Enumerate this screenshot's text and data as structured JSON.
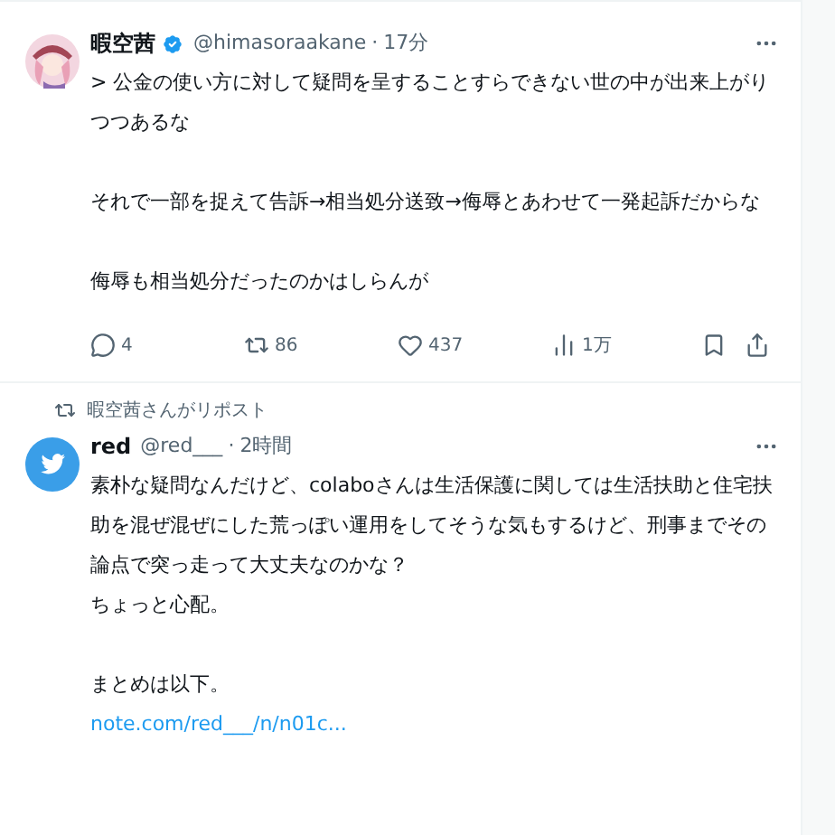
{
  "tweets": [
    {
      "author": {
        "kind": "character",
        "name": "暇空茜",
        "verified": true,
        "handle": "@himasoraakane",
        "separator": "·",
        "time": "17分"
      },
      "paragraphs": [
        [
          "> 公金の使い方に対して疑問を呈することすらできない世の中が出来上がり",
          "つつあるな"
        ],
        [
          "それで一部を捉えて告訴→相当処分送致→侮辱とあわせて一発起訴だからな"
        ],
        [
          "侮辱も相当処分だったのかはしらんが"
        ]
      ],
      "actions": [
        {
          "kind": "reply",
          "count": "4"
        },
        {
          "kind": "repost",
          "count": "86"
        },
        {
          "kind": "like",
          "count": "437"
        },
        {
          "kind": "views",
          "count": "1万"
        },
        {
          "kind": "bookmark"
        },
        {
          "kind": "share"
        }
      ]
    },
    {
      "repost_by": "暇空茜さんがリポスト",
      "author": {
        "kind": "bird",
        "name": "red",
        "verified": false,
        "handle": "@red___",
        "separator": "·",
        "time": "2時間"
      },
      "paragraphs": [
        [
          "素朴な疑問なんだけど、colaboさんは生活保護に関しては生活扶助と住宅扶",
          "助を混ぜ混ぜにした荒っぽい運用をしてそうな気もするけど、刑事までその",
          "論点で突っ走って大丈夫なのかな？",
          "ちょっと心配。"
        ],
        [
          "まとめは以下。"
        ]
      ],
      "link": "note.com/red___/n/n01c..."
    }
  ]
}
